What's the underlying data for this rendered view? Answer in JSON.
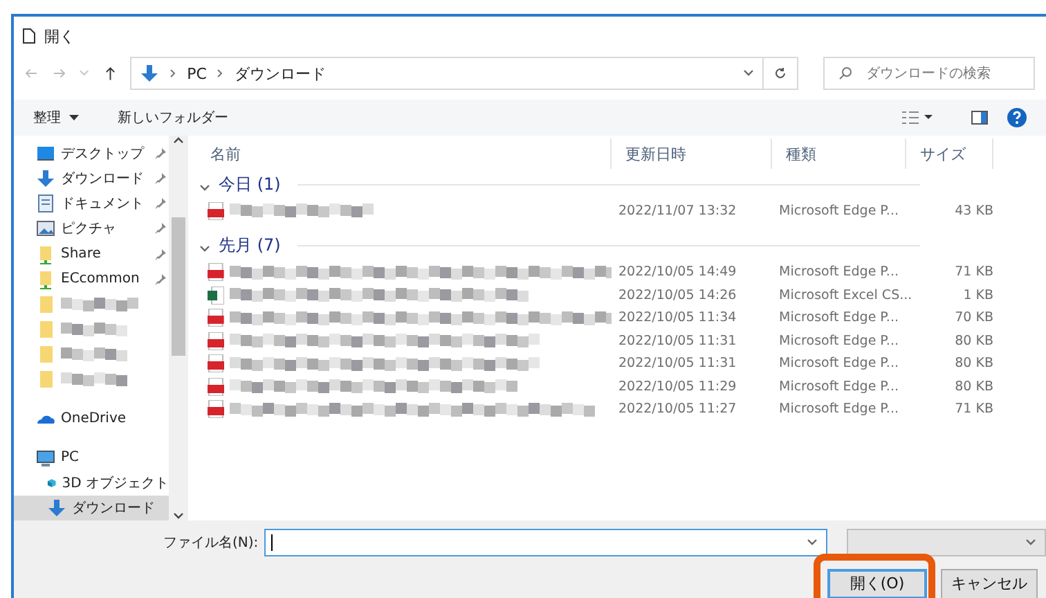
{
  "window": {
    "title": "開く"
  },
  "address": {
    "path": [
      "PC",
      "ダウンロード"
    ],
    "search_placeholder": "ダウンロードの検索"
  },
  "toolbar": {
    "organize": "整理",
    "new_folder": "新しいフォルダー"
  },
  "sidebar": {
    "items": [
      {
        "label": "デスクトップ",
        "kind": "desktop",
        "pinned": true,
        "selected": false
      },
      {
        "label": "ダウンロード",
        "kind": "download",
        "pinned": true,
        "selected": false
      },
      {
        "label": "ドキュメント",
        "kind": "document",
        "pinned": true,
        "selected": false
      },
      {
        "label": "ピクチャ",
        "kind": "picture",
        "pinned": true,
        "selected": false
      },
      {
        "label": "Share",
        "kind": "share",
        "pinned": true,
        "selected": false
      },
      {
        "label": "ECcommon",
        "kind": "share",
        "pinned": true,
        "selected": false
      },
      {
        "kind": "folder",
        "pinned": false,
        "selected": false
      },
      {
        "kind": "folder",
        "pinned": false,
        "selected": false
      },
      {
        "kind": "folder",
        "pinned": false,
        "selected": false
      },
      {
        "kind": "folder",
        "pinned": false,
        "selected": false
      },
      {
        "label": "OneDrive",
        "kind": "cloud",
        "pinned": false,
        "selected": false
      },
      {
        "label": "PC",
        "kind": "pc",
        "pinned": false,
        "selected": false,
        "children": [
          {
            "label": "3D オブジェクト",
            "kind": "cube",
            "pinned": false,
            "selected": false
          },
          {
            "label": "ダウンロード",
            "kind": "download",
            "pinned": false,
            "selected": true
          }
        ]
      }
    ]
  },
  "table": {
    "columns": [
      "名前",
      "更新日時",
      "種類",
      "サイズ"
    ],
    "groups": [
      {
        "title": "今日 (1)",
        "expanded": true,
        "rows": [
          {
            "kind": "pdf",
            "date": "2022/11/07 13:32",
            "type": "Microsoft Edge P...",
            "size": "43 KB"
          }
        ]
      },
      {
        "title": "先月 (7)",
        "expanded": true,
        "rows": [
          {
            "kind": "pdf",
            "date": "2022/10/05 14:49",
            "type": "Microsoft Edge P...",
            "size": "71 KB"
          },
          {
            "kind": "excel",
            "date": "2022/10/05 14:26",
            "type": "Microsoft Excel CS...",
            "size": "1 KB"
          },
          {
            "kind": "pdf",
            "date": "2022/10/05 11:34",
            "type": "Microsoft Edge P...",
            "size": "70 KB"
          },
          {
            "kind": "pdf",
            "date": "2022/10/05 11:31",
            "type": "Microsoft Edge P...",
            "size": "80 KB"
          },
          {
            "kind": "pdf",
            "date": "2022/10/05 11:31",
            "type": "Microsoft Edge P...",
            "size": "80 KB"
          },
          {
            "kind": "pdf",
            "date": "2022/10/05 11:29",
            "type": "Microsoft Edge P...",
            "size": "80 KB"
          },
          {
            "kind": "pdf",
            "date": "2022/10/05 11:27",
            "type": "Microsoft Edge P...",
            "size": "71 KB"
          }
        ]
      }
    ]
  },
  "footer": {
    "filename_label": "ファイル名(N):",
    "buttons": [
      {
        "label": "開く(O)",
        "default": true,
        "highlighted": true
      },
      {
        "label": "キャンセル",
        "default": false,
        "highlighted": false
      }
    ]
  }
}
